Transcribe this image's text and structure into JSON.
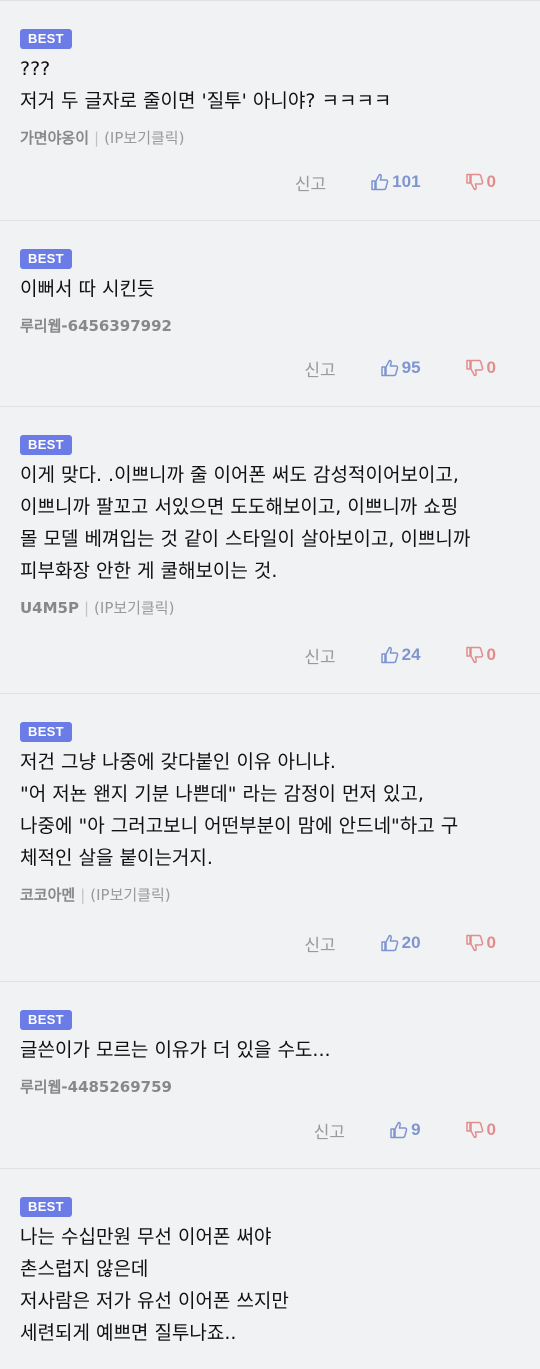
{
  "colors": {
    "badge": "#6c7ce6",
    "like": "#7e95cf",
    "dislike": "#e48c8c",
    "meta": "#999999",
    "background": "#f1f2f4"
  },
  "icons": {
    "like": "thumb-up-icon",
    "dislike": "thumb-down-icon"
  },
  "comments": [
    {
      "badge": "BEST",
      "lines": [
        "???",
        "저거 두 글자로 줄이면 '질투' 아니야? ㅋㅋㅋㅋ"
      ],
      "nickname": "가면야옹이",
      "ip": "(IP보기클릭)",
      "report": "신고",
      "likes": "101",
      "dislikes": "0"
    },
    {
      "badge": "BEST",
      "lines": [
        "이뻐서 따 시킨듯"
      ],
      "nickname": "루리웹-6456397992",
      "ip": "",
      "report": "신고",
      "likes": "95",
      "dislikes": "0"
    },
    {
      "badge": "BEST",
      "lines": [
        "이게 맞다. .이쁘니까 줄 이어폰 써도 감성적이어보이고,",
        "이쁘니까 팔꼬고 서있으면 도도해보이고, 이쁘니까 쇼핑",
        "몰 모델 베껴입는 것 같이 스타일이 살아보이고, 이쁘니까",
        "피부화장 안한 게 쿨해보이는 것."
      ],
      "nickname": "U4M5P",
      "ip": "(IP보기클릭)",
      "report": "신고",
      "likes": "24",
      "dislikes": "0"
    },
    {
      "badge": "BEST",
      "lines": [
        "저건 그냥 나중에 갖다붙인 이유 아니냐.",
        "\"어 저뇬 왠지 기분 나쁜데\" 라는 감정이 먼저 있고,",
        "나중에 \"아 그러고보니 어떤부분이 맘에 안드네\"하고 구",
        "체적인 살을 붙이는거지."
      ],
      "nickname": "코코아멘",
      "ip": "(IP보기클릭)",
      "report": "신고",
      "likes": "20",
      "dislikes": "0"
    },
    {
      "badge": "BEST",
      "lines": [
        "글쓴이가 모르는 이유가 더 있을 수도..."
      ],
      "nickname": "루리웹-4485269759",
      "ip": "",
      "report": "신고",
      "likes": "9",
      "dislikes": "0"
    },
    {
      "badge": "BEST",
      "lines": [
        "나는 수십만원 무선 이어폰 써야",
        "촌스럽지 않은데",
        "저사람은 저가 유선 이어폰 쓰지만",
        "세련되게 예쁘면 질투나죠.."
      ],
      "nickname": "",
      "ip": "",
      "report": "",
      "likes": "",
      "dislikes": ""
    }
  ]
}
